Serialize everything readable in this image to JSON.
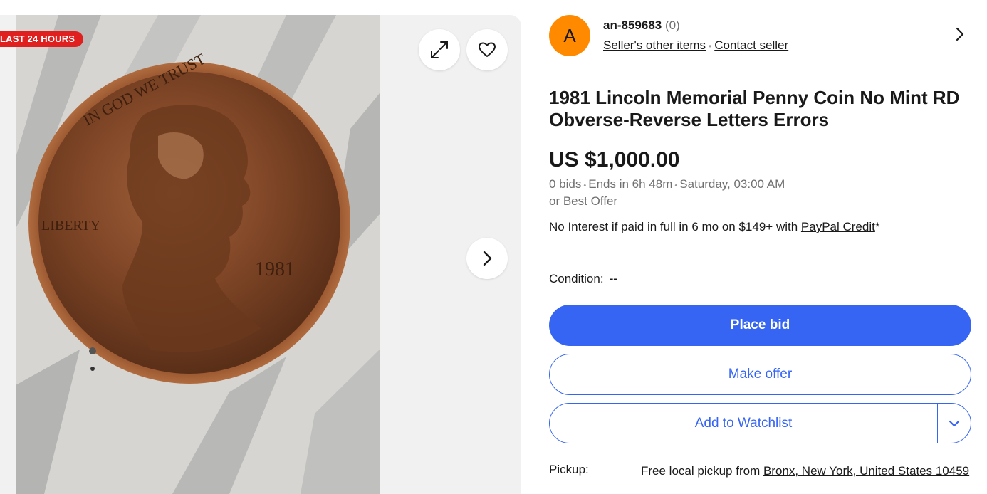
{
  "gallery": {
    "badge": "LAST 24 HOURS",
    "icons": {
      "expand": "expand-icon",
      "heart": "heart-icon",
      "next": "chevron-right-icon"
    },
    "coin_inscriptions": {
      "motto": "IN GOD WE TRUST",
      "liberty": "LIBERTY",
      "year": "1981"
    }
  },
  "seller": {
    "avatar_letter": "A",
    "name": "an-859683",
    "score": "(0)",
    "other_items": "Seller's other items",
    "contact": "Contact seller"
  },
  "listing": {
    "title": "1981 Lincoln Memorial Penny Coin No Mint RD Obverse-Reverse Letters Errors",
    "price": "US $1,000.00",
    "bids": "0 bids",
    "ends": "Ends in 6h 48m",
    "end_time": "Saturday, 03:00 AM",
    "best_offer": "or Best Offer",
    "financing_text": "No Interest if paid in full in 6 mo on $149+ with ",
    "financing_link": "PayPal Credit",
    "financing_suffix": "*",
    "condition_label": "Condition:",
    "condition_value": "--"
  },
  "actions": {
    "place_bid": "Place bid",
    "make_offer": "Make offer",
    "add_watchlist": "Add to Watchlist"
  },
  "pickup": {
    "label": "Pickup:",
    "text": "Free local pickup from ",
    "location": "Bronx, New York, United States 10459"
  },
  "colors": {
    "primary": "#3665f3",
    "badge": "#e0201f",
    "avatar": "#ff8a00"
  }
}
